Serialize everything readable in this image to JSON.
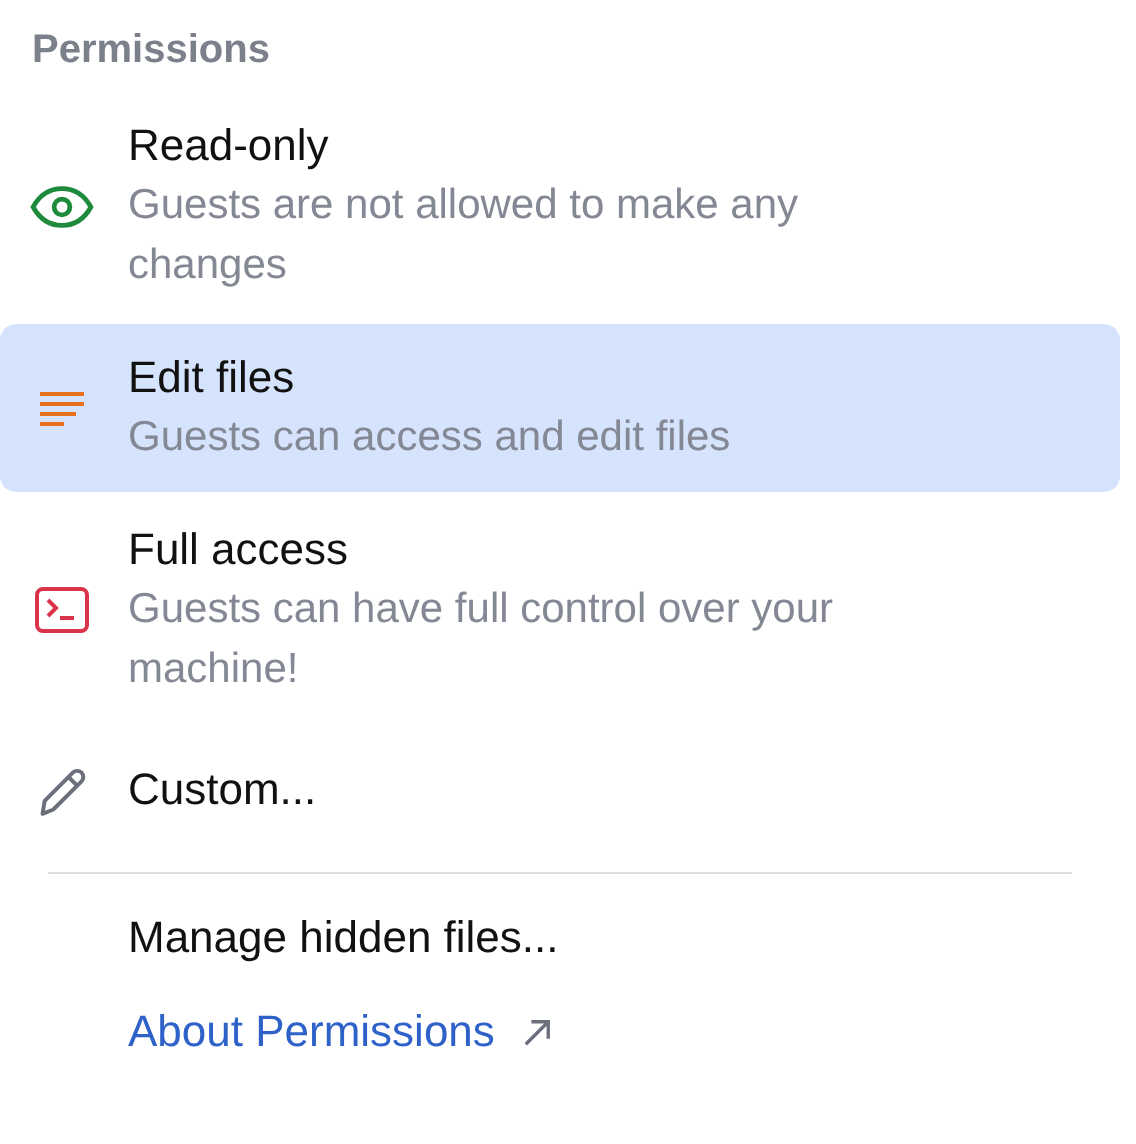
{
  "section_title": "Permissions",
  "options": [
    {
      "kind": "option",
      "color": "#1e8a3c",
      "title": "Read-only",
      "description": "Guests are not allowed to make any changes",
      "selected": false
    },
    {
      "kind": "option",
      "color": "#e8711c",
      "title": "Edit files",
      "description": "Guests can access and edit files",
      "selected": true
    },
    {
      "kind": "option",
      "color": "#d9344a",
      "title": "Full access",
      "description": "Guests can have full control over your machine!",
      "selected": false
    },
    {
      "kind": "action",
      "color": "#6b6f7b",
      "title": "Custom...",
      "selected": false
    }
  ],
  "footer_items": [
    {
      "kind": "action",
      "label": "Manage hidden files..."
    },
    {
      "kind": "link",
      "label": "About Permissions"
    }
  ]
}
